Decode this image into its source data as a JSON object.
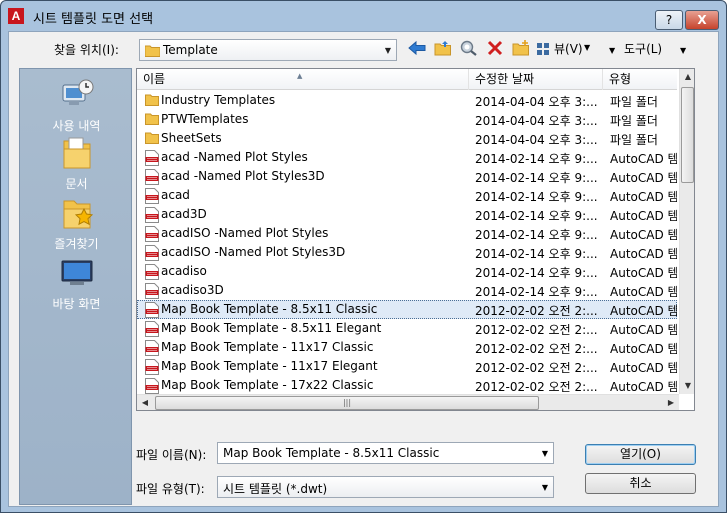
{
  "window": {
    "title": "시트 템플릿 도면 선택",
    "app_icon_letter": "A",
    "help_label": "?",
    "close_label": "X"
  },
  "toolbar": {
    "look_in_label": "찾을 위치(I):",
    "look_in_value": "Template",
    "view_label": "뷰(V)",
    "tools_label": "도구(L)",
    "icons": [
      "back-icon",
      "up-folder-icon",
      "search-web-icon",
      "delete-icon",
      "new-folder-icon",
      "views-icon"
    ]
  },
  "places": [
    {
      "label": "사용 내역",
      "icon": "history-icon"
    },
    {
      "label": "문서",
      "icon": "documents-icon"
    },
    {
      "label": "즐겨찾기",
      "icon": "favorites-icon"
    },
    {
      "label": "바탕 화면",
      "icon": "desktop-icon"
    }
  ],
  "columns": {
    "name": "이름",
    "date": "수정한 날짜",
    "type": "유형"
  },
  "files": [
    {
      "kind": "folder",
      "name": "Industry Templates",
      "date": "2014-04-04 오후 3:...",
      "type": "파일 폴더"
    },
    {
      "kind": "folder",
      "name": "PTWTemplates",
      "date": "2014-04-04 오후 3:...",
      "type": "파일 폴더"
    },
    {
      "kind": "folder",
      "name": "SheetSets",
      "date": "2014-04-04 오후 3:...",
      "type": "파일 폴더"
    },
    {
      "kind": "dwt",
      "name": "acad -Named Plot Styles",
      "date": "2014-02-14 오후 9:...",
      "type": "AutoCAD 템플"
    },
    {
      "kind": "dwt",
      "name": "acad -Named Plot Styles3D",
      "date": "2014-02-14 오후 9:...",
      "type": "AutoCAD 템플"
    },
    {
      "kind": "dwt",
      "name": "acad",
      "date": "2014-02-14 오후 9:...",
      "type": "AutoCAD 템플"
    },
    {
      "kind": "dwt",
      "name": "acad3D",
      "date": "2014-02-14 오후 9:...",
      "type": "AutoCAD 템플"
    },
    {
      "kind": "dwt",
      "name": "acadISO -Named Plot Styles",
      "date": "2014-02-14 오후 9:...",
      "type": "AutoCAD 템플"
    },
    {
      "kind": "dwt",
      "name": "acadISO -Named Plot Styles3D",
      "date": "2014-02-14 오후 9:...",
      "type": "AutoCAD 템플"
    },
    {
      "kind": "dwt",
      "name": "acadiso",
      "date": "2014-02-14 오후 9:...",
      "type": "AutoCAD 템플"
    },
    {
      "kind": "dwt",
      "name": "acadiso3D",
      "date": "2014-02-14 오후 9:...",
      "type": "AutoCAD 템플"
    },
    {
      "kind": "dwt",
      "name": "Map Book Template - 8.5x11 Classic",
      "date": "2012-02-02 오전 2:...",
      "type": "AutoCAD 템플",
      "selected": true
    },
    {
      "kind": "dwt",
      "name": "Map Book Template - 8.5x11 Elegant",
      "date": "2012-02-02 오전 2:...",
      "type": "AutoCAD 템플"
    },
    {
      "kind": "dwt",
      "name": "Map Book Template - 11x17 Classic",
      "date": "2012-02-02 오전 2:...",
      "type": "AutoCAD 템플"
    },
    {
      "kind": "dwt",
      "name": "Map Book Template - 11x17 Elegant",
      "date": "2012-02-02 오전 2:...",
      "type": "AutoCAD 템플"
    },
    {
      "kind": "dwt",
      "name": "Map Book Template - 17x22 Classic",
      "date": "2012-02-02 오전 2:...",
      "type": "AutoCAD 템플"
    }
  ],
  "footer": {
    "filename_label": "파일 이름(N):",
    "filename_value": "Map Book Template - 8.5x11 Classic",
    "filetype_label": "파일 유형(T):",
    "filetype_value": "시트 템플릿 (*.dwt)",
    "open_label": "열기(O)",
    "cancel_label": "취소"
  },
  "colors": {
    "dwt_icon_red": "#c8161d",
    "folder_yellow": "#f1c24a",
    "selection_blue": "#dfeaf7"
  }
}
